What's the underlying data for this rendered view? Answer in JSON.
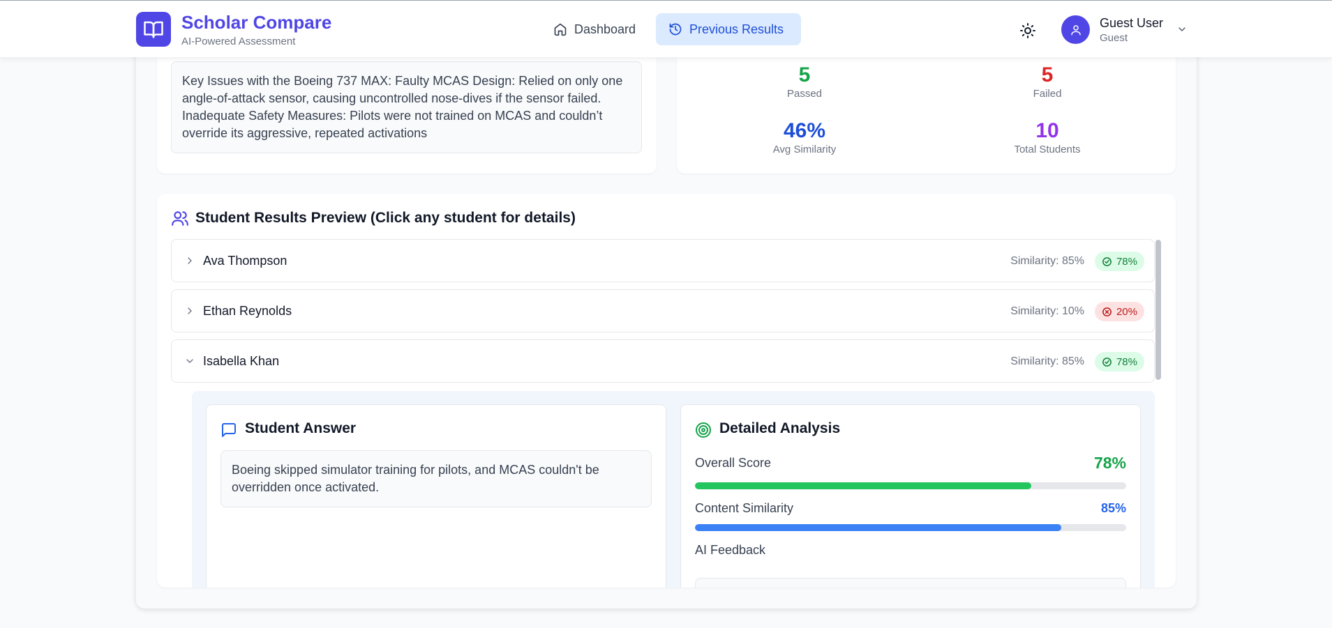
{
  "app": {
    "title": "Scholar Compare",
    "subtitle": "AI-Powered Assessment"
  },
  "nav": {
    "dashboard": "Dashboard",
    "previous_results": "Previous Results"
  },
  "user": {
    "name": "Guest User",
    "role": "Guest"
  },
  "question": {
    "text": "Key Issues with the Boeing 737 MAX: Faulty MCAS Design: Relied on only one angle-of-attack sensor, causing uncontrolled nose-dives if the sensor failed. Inadequate Safety Measures: Pilots were not trained on MCAS and couldn’t override its aggressive, repeated activations"
  },
  "stats": {
    "passed": {
      "value": "5",
      "label": "Passed",
      "color": "#16a34a"
    },
    "failed": {
      "value": "5",
      "label": "Failed",
      "color": "#dc2626"
    },
    "avg_similarity": {
      "value": "46%",
      "label": "Avg Similarity",
      "color": "#1d4ed8"
    },
    "total_students": {
      "value": "10",
      "label": "Total Students",
      "color": "#9333ea"
    }
  },
  "results": {
    "title": "Student Results Preview (Click any student for details)",
    "students": [
      {
        "name": "Ava Thompson",
        "similarity": "Similarity: 85%",
        "score": "78%",
        "status": "pass",
        "expanded": false
      },
      {
        "name": "Ethan Reynolds",
        "similarity": "Similarity: 10%",
        "score": "20%",
        "status": "fail",
        "expanded": false
      },
      {
        "name": "Isabella Khan",
        "similarity": "Similarity: 85%",
        "score": "78%",
        "status": "pass",
        "expanded": true
      }
    ]
  },
  "detail": {
    "answer_title": "Student Answer",
    "answer_text": "Boeing skipped simulator training for pilots, and MCAS couldn't be overridden once activated.",
    "analysis_title": "Detailed Analysis",
    "overall_label": "Overall Score",
    "overall_value": "78%",
    "overall_fraction": 0.78,
    "similarity_label": "Content Similarity",
    "similarity_value": "85%",
    "similarity_fraction": 0.85,
    "feedback_label": "AI Feedback"
  },
  "colors": {
    "brand": "#4f46e5",
    "pass": "#22c55e",
    "similarity": "#3b82f6"
  }
}
